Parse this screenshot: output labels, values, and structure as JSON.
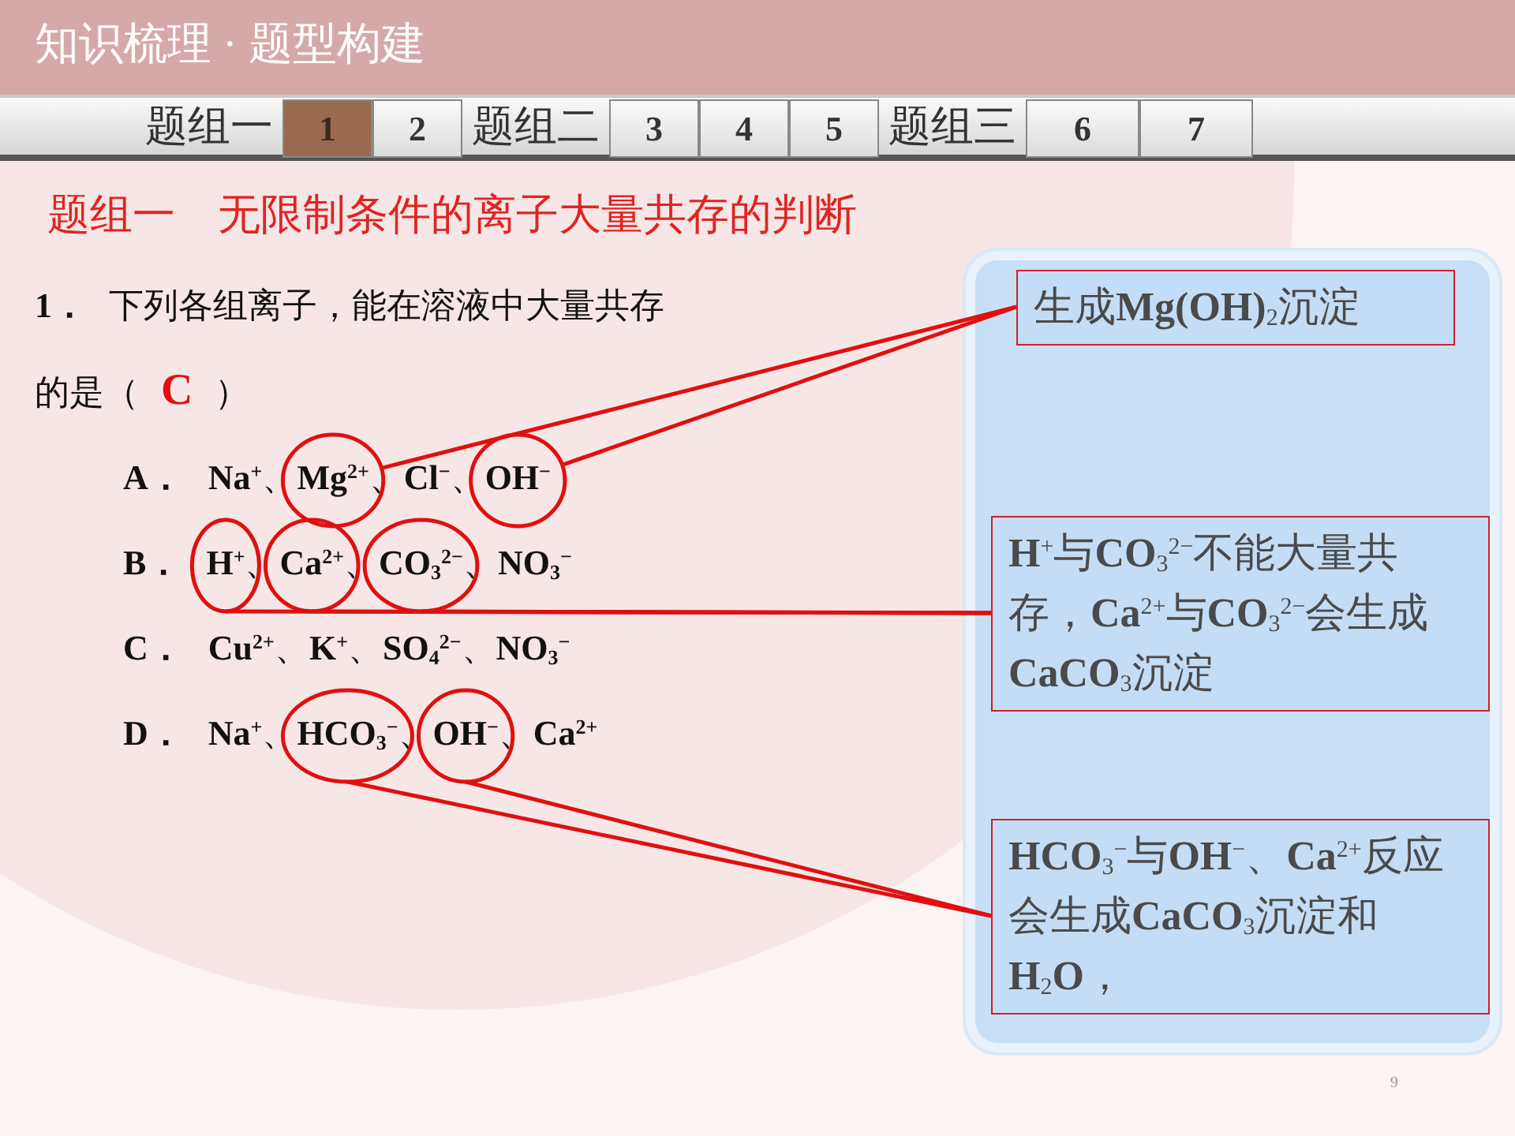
{
  "header": {
    "title": "知识梳理 · 题型构建"
  },
  "nav": {
    "groups": [
      {
        "label": "题组一",
        "tabs": [
          {
            "label": "1",
            "selected": true
          },
          {
            "label": "2",
            "selected": false
          }
        ]
      },
      {
        "label": "题组二",
        "tabs": [
          {
            "label": "3",
            "selected": false
          },
          {
            "label": "4",
            "selected": false
          },
          {
            "label": "5",
            "selected": false
          }
        ]
      },
      {
        "label": "题组三",
        "tabs": [
          {
            "label": "6",
            "selected": false
          },
          {
            "label": "7",
            "selected": false
          }
        ]
      }
    ]
  },
  "heading": "题组一　无限制条件的离子大量共存的判断",
  "question": {
    "number": "1．",
    "text": "下列各组离子，能在溶液中大量共存的是",
    "open": "（",
    "answer": "C",
    "close": "）"
  },
  "options": [
    {
      "letter": "A．",
      "separator": "、",
      "ions": [
        {
          "text": "Na$^{+}$",
          "circled": false
        },
        {
          "text": "Mg$^{2+}$",
          "circled": true
        },
        {
          "text": "Cl$^{−}$",
          "circled": false
        },
        {
          "text": "OH$^{−}$",
          "circled": true
        }
      ]
    },
    {
      "letter": "B．",
      "separator": "、",
      "ions": [
        {
          "text": "H$^{+}$",
          "circled": true
        },
        {
          "text": "Ca$^{2+}$",
          "circled": true
        },
        {
          "text": "CO$_{3}$$^{2−}$",
          "circled": true
        },
        {
          "text": "NO$_{3}$$^{−}$",
          "circled": false
        }
      ]
    },
    {
      "letter": "C．",
      "separator": "、",
      "ions": [
        {
          "text": "Cu$^{2+}$",
          "circled": false
        },
        {
          "text": "K$^{+}$",
          "circled": false
        },
        {
          "text": "SO$_{4}$$^{2−}$",
          "circled": false
        },
        {
          "text": "NO$_{3}$$^{−}$",
          "circled": false
        }
      ]
    },
    {
      "letter": "D．",
      "separator": "、",
      "ions": [
        {
          "text": "Na$^{+}$",
          "circled": false
        },
        {
          "text": "HCO$_{3}$$^{−}$",
          "circled": true
        },
        {
          "text": "OH$^{−}$",
          "circled": true
        },
        {
          "text": "Ca$^{2+}$",
          "circled": false
        }
      ]
    }
  ],
  "notes": [
    "生成**Mg(OH)**$_{2}$沉淀",
    "**H**$^{+}$与**CO**$_{3}$$^{2−}$不能大量共存，**Ca**$^{2+}$与**CO**$_{3}$$^{2−}$会生成**CaCO**$_{3}$沉淀",
    "**HCO**$_{3}$$^{−}$与**OH**$^{−}$、**Ca**$^{2+}$反应会生成**CaCO**$_{3}$沉淀和**H**$_{2}$**O**，"
  ],
  "page_number": "9"
}
